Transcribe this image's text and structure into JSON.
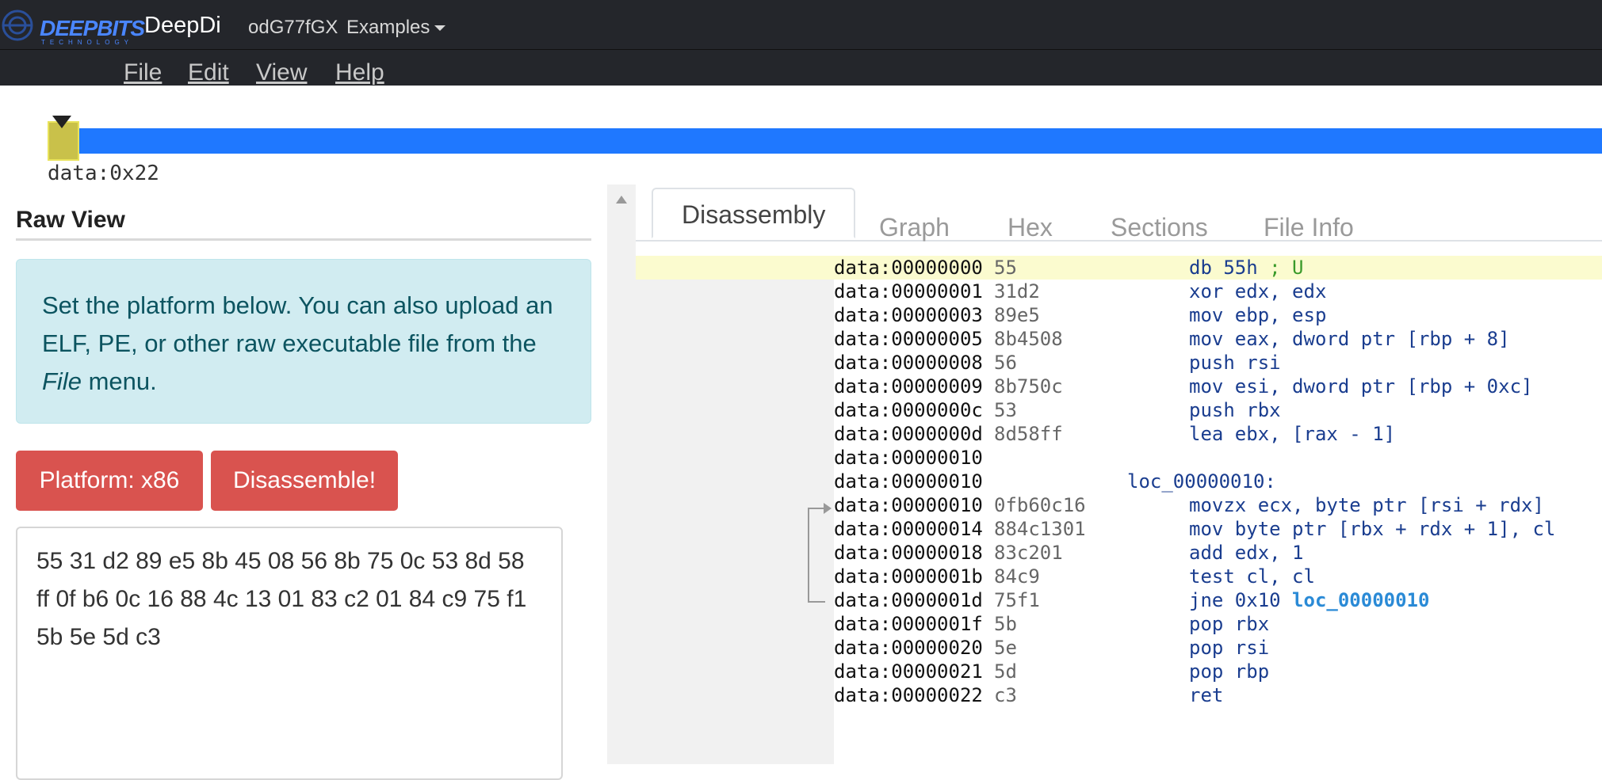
{
  "header": {
    "logo_text": "DEEPBITS",
    "logo_subtext": "TECHNOLOGY",
    "brand": "DeepDi",
    "doc_id": "odG77fGX",
    "examples_label": "Examples"
  },
  "menu": [
    "File",
    "Edit",
    "View",
    "Help"
  ],
  "navigator": {
    "label": "data:0x22"
  },
  "raw_view": {
    "title": "Raw View",
    "info_pre": "Set the platform below. You can also upload an ELF, PE, or other raw executable file from the ",
    "info_em": "File",
    "info_post": " menu.",
    "platform_button": "Platform: x86",
    "disassemble_button": "Disassemble!",
    "hex_input": "55 31 d2 89 e5 8b 45 08 56 8b 75 0c 53 8d 58 ff 0f b6 0c 16 88 4c 13 01 83 c2 01 84 c9 75 f1 5b 5e 5d c3"
  },
  "tabs": [
    "Disassembly",
    "Graph",
    "Hex",
    "Sections",
    "File Info"
  ],
  "active_tab": "Disassembly",
  "disassembly": [
    {
      "addr": "data:00000000",
      "bytes": "55",
      "instr": "db 55h",
      "comment": "; U"
    },
    {
      "addr": "data:00000001",
      "bytes": "31d2",
      "instr": "xor edx, edx"
    },
    {
      "addr": "data:00000003",
      "bytes": "89e5",
      "instr": "mov ebp, esp"
    },
    {
      "addr": "data:00000005",
      "bytes": "8b4508",
      "instr": "mov eax, dword ptr [rbp + 8]"
    },
    {
      "addr": "data:00000008",
      "bytes": "56",
      "instr": "push rsi"
    },
    {
      "addr": "data:00000009",
      "bytes": "8b750c",
      "instr": "mov esi, dword ptr [rbp + 0xc]"
    },
    {
      "addr": "data:0000000c",
      "bytes": "53",
      "instr": "push rbx"
    },
    {
      "addr": "data:0000000d",
      "bytes": "8d58ff",
      "instr": "lea ebx, [rax - 1]"
    },
    {
      "addr": "data:00000010",
      "bytes": "",
      "instr": ""
    },
    {
      "addr": "data:00000010",
      "bytes": "",
      "label": "loc_00000010:"
    },
    {
      "addr": "data:00000010",
      "bytes": "0fb60c16",
      "instr": "movzx ecx, byte ptr [rsi + rdx]"
    },
    {
      "addr": "data:00000014",
      "bytes": "884c1301",
      "instr": "mov byte ptr [rbx + rdx + 1], cl"
    },
    {
      "addr": "data:00000018",
      "bytes": "83c201",
      "instr": "add edx, 1"
    },
    {
      "addr": "data:0000001b",
      "bytes": "84c9",
      "instr": "test cl, cl"
    },
    {
      "addr": "data:0000001d",
      "bytes": "75f1",
      "instr": "jne 0x10",
      "target": "loc_00000010"
    },
    {
      "addr": "data:0000001f",
      "bytes": "5b",
      "instr": "pop rbx"
    },
    {
      "addr": "data:00000020",
      "bytes": "5e",
      "instr": "pop rsi"
    },
    {
      "addr": "data:00000021",
      "bytes": "5d",
      "instr": "pop rbp"
    },
    {
      "addr": "data:00000022",
      "bytes": "c3",
      "instr": "ret"
    }
  ]
}
